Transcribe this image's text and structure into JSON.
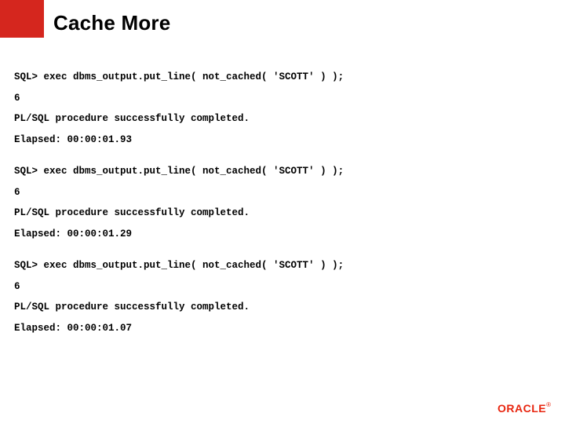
{
  "title": "Cache More",
  "logo": {
    "text": "ORACLE",
    "registered": "®"
  },
  "runs": [
    {
      "cmd": "SQL> exec dbms_output.put_line( not_cached( 'SCOTT' ) );",
      "result": "6",
      "status": "PL/SQL procedure successfully completed.",
      "elapsed": "Elapsed: 00:00:01.93"
    },
    {
      "cmd": "SQL> exec dbms_output.put_line( not_cached( 'SCOTT' ) );",
      "result": "6",
      "status": "PL/SQL procedure successfully completed.",
      "elapsed": "Elapsed: 00:00:01.29"
    },
    {
      "cmd": "SQL> exec dbms_output.put_line( not_cached( 'SCOTT' ) );",
      "result": "6",
      "status": "PL/SQL procedure successfully completed.",
      "elapsed": "Elapsed: 00:00:01.07"
    }
  ]
}
